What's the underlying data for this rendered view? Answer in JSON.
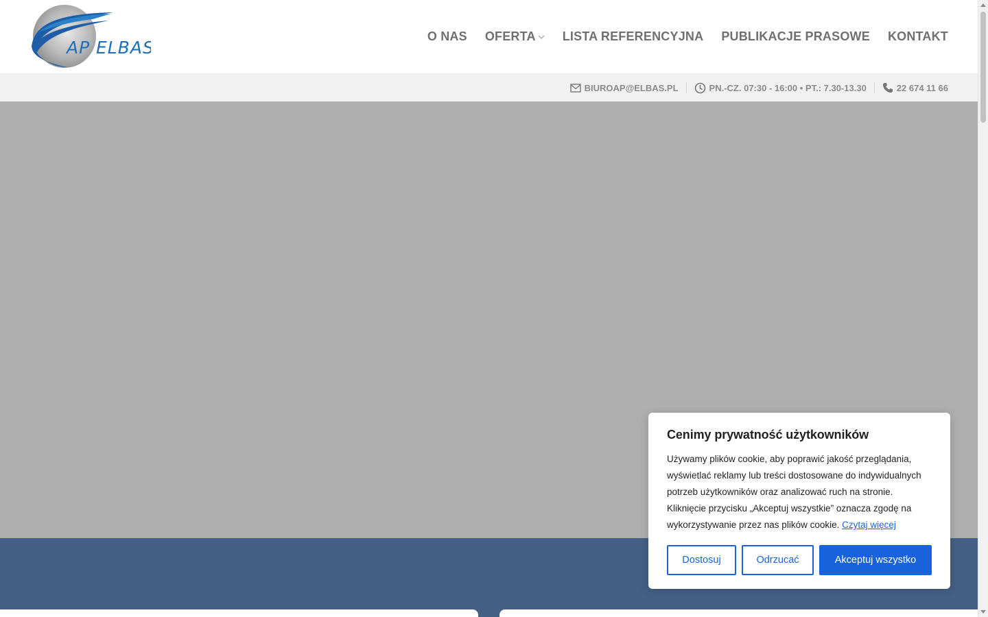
{
  "header": {
    "logo_text": "AP ELBAS",
    "nav": [
      {
        "label": "O NAS",
        "has_dropdown": false
      },
      {
        "label": "OFERTA",
        "has_dropdown": true
      },
      {
        "label": "LISTA REFERENCYJNA",
        "has_dropdown": false
      },
      {
        "label": "PUBLIKACJE PRASOWE",
        "has_dropdown": false
      },
      {
        "label": "KONTAKT",
        "has_dropdown": false
      }
    ]
  },
  "topbar": {
    "email": "BIUROAP@ELBAS.PL",
    "hours": "PN.-CZ. 07:30 - 16:00 • PT.: 7.30-13.30",
    "phone": "22 674 11 66",
    "icons": [
      "envelope-icon",
      "clock-icon",
      "phone-icon"
    ]
  },
  "cookie": {
    "title": "Cenimy prywatność użytkowników",
    "body": "Używamy plików cookie, aby poprawić jakość przeglądania, wyświetlać reklamy lub treści dostosowane do indywidualnych potrzeb użytkowników oraz analizować ruch na stronie. Kliknięcie przycisku „Akceptuj wszystkie” oznacza zgodę na wykorzystywanie przez nas plików cookie.",
    "link": "Czytaj więcej",
    "buttons": {
      "customize": "Dostosuj",
      "reject": "Odrzucać",
      "accept": "Akceptuj wszystko"
    }
  },
  "colors": {
    "nav_text": "#6f6f6f",
    "topbar_bg": "#f1f1f1",
    "hero_bg": "#afafaf",
    "band_bg": "#456085",
    "accent": "#1863dc",
    "logo_blue": "#1f6fb5"
  }
}
